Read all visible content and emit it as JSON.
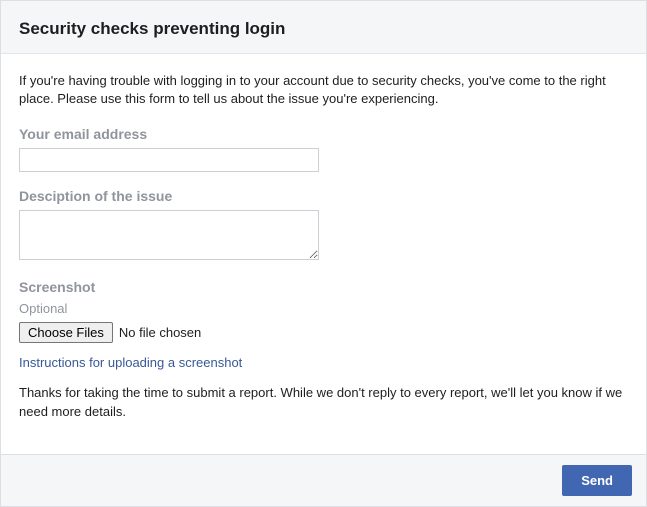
{
  "header": {
    "title": "Security checks preventing login"
  },
  "intro": "If you're having trouble with logging in to your account due to security checks, you've come to the right place. Please use this form to tell us about the issue you're experiencing.",
  "fields": {
    "email": {
      "label": "Your email address",
      "value": ""
    },
    "description": {
      "label": "Desciption of the issue",
      "value": ""
    },
    "screenshot": {
      "label": "Screenshot",
      "sublabel": "Optional",
      "button": "Choose Files",
      "status": "No file chosen"
    }
  },
  "instructions_link": "Instructions for uploading a screenshot",
  "thanks": "Thanks for taking the time to submit a report. While we don't reply to every report, we'll let you know if we need more details.",
  "footer": {
    "send": "Send"
  }
}
